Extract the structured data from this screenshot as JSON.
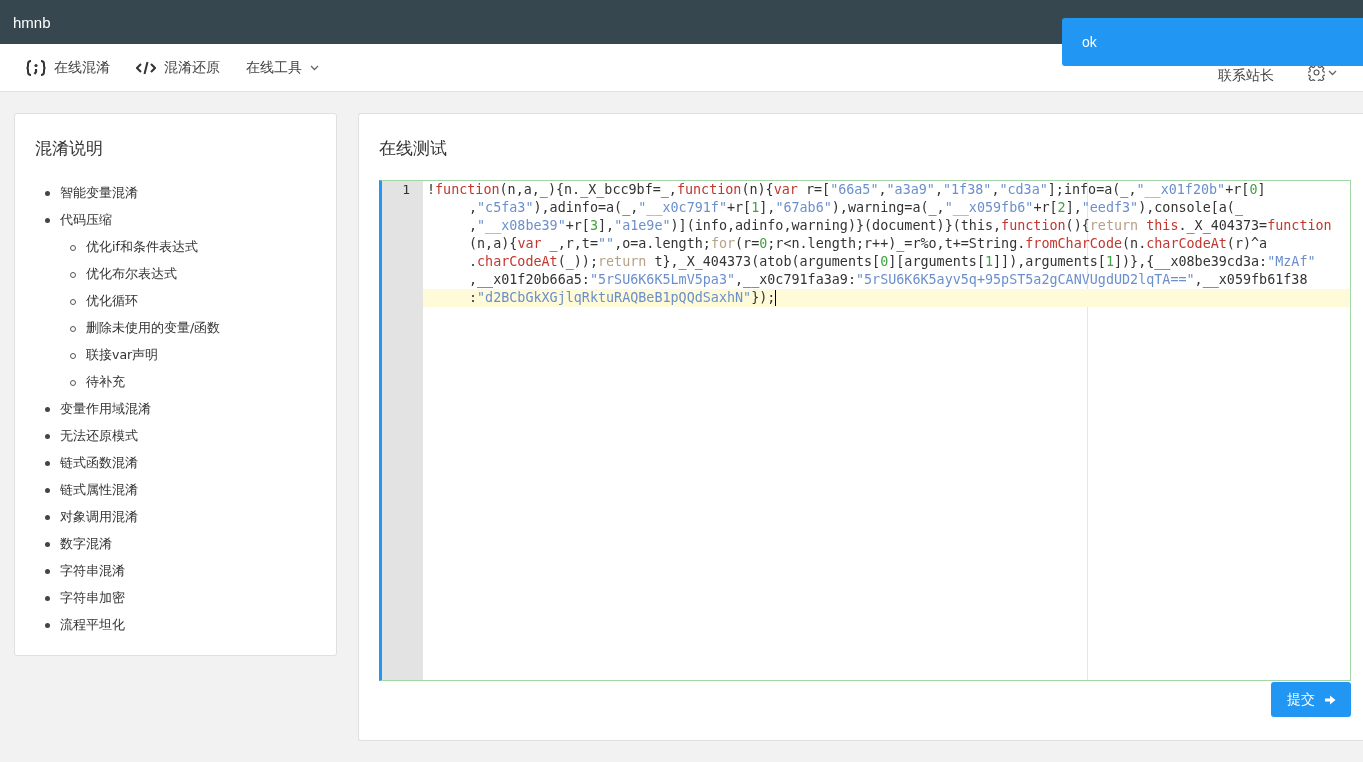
{
  "app": {
    "title": "hmnb"
  },
  "nav": {
    "items": [
      {
        "label": "在线混淆",
        "kind": "braces",
        "dropdown": false
      },
      {
        "label": "混淆还原",
        "kind": "code",
        "dropdown": false
      },
      {
        "label": "在线工具",
        "kind": "plain",
        "dropdown": true
      }
    ],
    "contact": "联系站长"
  },
  "toast": {
    "message": "ok"
  },
  "sidebar": {
    "title": "混淆说明",
    "items": [
      {
        "label": "智能变量混淆"
      },
      {
        "label": "代码压缩",
        "children": [
          {
            "label": "优化if和条件表达式"
          },
          {
            "label": "优化布尔表达式"
          },
          {
            "label": "优化循环"
          },
          {
            "label": "删除未使用的变量/函数"
          },
          {
            "label": "联接var声明"
          },
          {
            "label": "待补充"
          }
        ]
      },
      {
        "label": "变量作用域混淆"
      },
      {
        "label": "无法还原模式"
      },
      {
        "label": "链式函数混淆"
      },
      {
        "label": "链式属性混淆"
      },
      {
        "label": "对象调用混淆"
      },
      {
        "label": "数字混淆"
      },
      {
        "label": "字符串混淆"
      },
      {
        "label": "字符串加密"
      },
      {
        "label": "流程平坦化"
      }
    ]
  },
  "main": {
    "title": "在线测试",
    "editor": {
      "line_number": "1",
      "rows": [
        {
          "highlighted": false,
          "tokens": [
            {
              "kind": "plain",
              "text": "!"
            },
            {
              "kind": "keyword",
              "text": "function"
            },
            {
              "kind": "plain",
              "text": "(n,a,_){n._X_bcc9bf=_,"
            },
            {
              "kind": "keyword",
              "text": "function"
            },
            {
              "kind": "plain",
              "text": "(n){"
            },
            {
              "kind": "keyword",
              "text": "var"
            },
            {
              "kind": "plain",
              "text": " r=["
            },
            {
              "kind": "string",
              "text": "\"66a5\""
            },
            {
              "kind": "plain",
              "text": ","
            },
            {
              "kind": "string",
              "text": "\"a3a9\""
            },
            {
              "kind": "plain",
              "text": ","
            },
            {
              "kind": "string",
              "text": "\"1f38\""
            },
            {
              "kind": "plain",
              "text": ","
            },
            {
              "kind": "string",
              "text": "\"cd3a\""
            },
            {
              "kind": "plain",
              "text": "];info=a(_,"
            },
            {
              "kind": "string",
              "text": "\"__x01f20b\""
            },
            {
              "kind": "plain",
              "text": "+r["
            },
            {
              "kind": "number",
              "text": "0"
            },
            {
              "kind": "plain",
              "text": "]"
            }
          ]
        },
        {
          "highlighted": false,
          "tokens": [
            {
              "kind": "plain",
              "text": ","
            },
            {
              "kind": "string",
              "text": "\"c5fa3\""
            },
            {
              "kind": "plain",
              "text": "),adinfo=a(_,"
            },
            {
              "kind": "string",
              "text": "\"__x0c791f\""
            },
            {
              "kind": "plain",
              "text": "+r["
            },
            {
              "kind": "number",
              "text": "1"
            },
            {
              "kind": "plain",
              "text": "],"
            },
            {
              "kind": "string",
              "text": "\"67ab6\""
            },
            {
              "kind": "plain",
              "text": "),warning=a(_,"
            },
            {
              "kind": "string",
              "text": "\"__x059fb6\""
            },
            {
              "kind": "plain",
              "text": "+r["
            },
            {
              "kind": "number",
              "text": "2"
            },
            {
              "kind": "plain",
              "text": "],"
            },
            {
              "kind": "string",
              "text": "\"eedf3\""
            },
            {
              "kind": "plain",
              "text": "),console[a(_"
            }
          ]
        },
        {
          "highlighted": false,
          "tokens": [
            {
              "kind": "plain",
              "text": ","
            },
            {
              "kind": "string",
              "text": "\"__x08be39\""
            },
            {
              "kind": "plain",
              "text": "+r["
            },
            {
              "kind": "number",
              "text": "3"
            },
            {
              "kind": "plain",
              "text": "],"
            },
            {
              "kind": "string",
              "text": "\"a1e9e\""
            },
            {
              "kind": "plain",
              "text": ")](info,adinfo,warning)}(document)}(this,"
            },
            {
              "kind": "keyword",
              "text": "function"
            },
            {
              "kind": "plain",
              "text": "(){"
            },
            {
              "kind": "control",
              "text": "return"
            },
            {
              "kind": "keyword",
              "text": " this"
            },
            {
              "kind": "plain",
              "text": "._X_404373="
            },
            {
              "kind": "keyword",
              "text": "function"
            }
          ]
        },
        {
          "highlighted": false,
          "tokens": [
            {
              "kind": "plain",
              "text": "(n,a){"
            },
            {
              "kind": "keyword",
              "text": "var"
            },
            {
              "kind": "plain",
              "text": " _,r,t="
            },
            {
              "kind": "string",
              "text": "\"\""
            },
            {
              "kind": "plain",
              "text": ",o=a.length;"
            },
            {
              "kind": "control",
              "text": "for"
            },
            {
              "kind": "plain",
              "text": "(r="
            },
            {
              "kind": "number",
              "text": "0"
            },
            {
              "kind": "plain",
              "text": ";r<n.length;r++)_=r%o,t+=String."
            },
            {
              "kind": "keyword",
              "text": "fromCharCode"
            },
            {
              "kind": "plain",
              "text": "(n."
            },
            {
              "kind": "keyword",
              "text": "charCodeAt"
            },
            {
              "kind": "plain",
              "text": "(r)^a"
            }
          ]
        },
        {
          "highlighted": false,
          "tokens": [
            {
              "kind": "plain",
              "text": "."
            },
            {
              "kind": "keyword",
              "text": "charCodeAt"
            },
            {
              "kind": "plain",
              "text": "(_));"
            },
            {
              "kind": "control",
              "text": "return"
            },
            {
              "kind": "plain",
              "text": " t},_X_404373(atob(arguments["
            },
            {
              "kind": "number",
              "text": "0"
            },
            {
              "kind": "plain",
              "text": "][arguments["
            },
            {
              "kind": "number",
              "text": "1"
            },
            {
              "kind": "plain",
              "text": "]]),arguments["
            },
            {
              "kind": "number",
              "text": "1"
            },
            {
              "kind": "plain",
              "text": "])},{__x08be39cd3a:"
            },
            {
              "kind": "string",
              "text": "\"MzAf\""
            }
          ]
        },
        {
          "highlighted": false,
          "tokens": [
            {
              "kind": "plain",
              "text": ",__x01f20b66a5:"
            },
            {
              "kind": "string",
              "text": "\"5rSU6K6K5LmV5pa3\""
            },
            {
              "kind": "plain",
              "text": ",__x0c791fa3a9:"
            },
            {
              "kind": "string",
              "text": "\"5rSU6K6K5ayv5q+95pST5a2gCANVUgdUD2lqTA==\""
            },
            {
              "kind": "plain",
              "text": ",__x059fb61f38"
            }
          ]
        },
        {
          "highlighted": true,
          "tokens": [
            {
              "kind": "plain",
              "text": ":"
            },
            {
              "kind": "string",
              "text": "\"d2BCbGkXGjlqRktuRAQBeB1pQQdSaxhN\""
            },
            {
              "kind": "plain",
              "text": "});"
            }
          ]
        }
      ]
    },
    "submit": {
      "label": "提交"
    }
  }
}
